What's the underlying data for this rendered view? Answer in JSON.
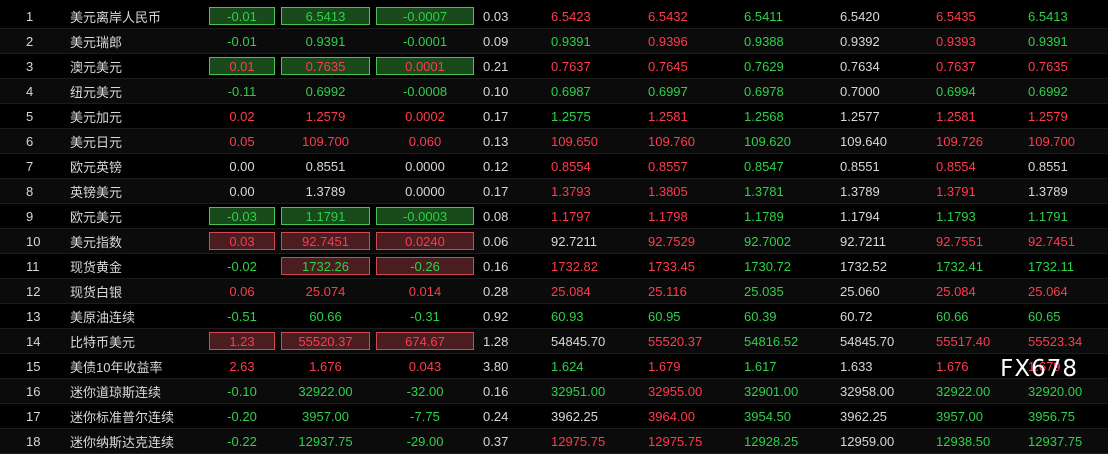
{
  "colors": {
    "up": "#ff3b4e",
    "down": "#2fd04a",
    "flat": "#d8d8d8",
    "background": "#000000"
  },
  "watermark": "FX678",
  "rows": [
    {
      "no": "1",
      "name": "美元离岸人民币",
      "change": "-0.01",
      "last": "6.5413",
      "chg": "-0.0007",
      "pct": "0.03",
      "open": "6.5423",
      "high": "6.5432",
      "low": "6.5411",
      "prev": "6.5420",
      "bid": "6.5435",
      "ask": "6.5413",
      "hl": "green",
      "c_change": "down",
      "c_last": "down",
      "c_chg": "down",
      "c_open": "up",
      "c_high": "up",
      "c_low": "down",
      "c_prev": "flat",
      "c_bid": "up",
      "c_ask": "down"
    },
    {
      "no": "2",
      "name": "美元瑞郎",
      "change": "-0.01",
      "last": "0.9391",
      "chg": "-0.0001",
      "pct": "0.09",
      "open": "0.9391",
      "high": "0.9396",
      "low": "0.9388",
      "prev": "0.9392",
      "bid": "0.9393",
      "ask": "0.9391",
      "hl": "",
      "c_change": "down",
      "c_last": "down",
      "c_chg": "down",
      "c_open": "down",
      "c_high": "up",
      "c_low": "down",
      "c_prev": "flat",
      "c_bid": "up",
      "c_ask": "down"
    },
    {
      "no": "3",
      "name": "澳元美元",
      "change": "0.01",
      "last": "0.7635",
      "chg": "0.0001",
      "pct": "0.21",
      "open": "0.7637",
      "high": "0.7645",
      "low": "0.7629",
      "prev": "0.7634",
      "bid": "0.7637",
      "ask": "0.7635",
      "hl": "green",
      "c_change": "up",
      "c_last": "up",
      "c_chg": "up",
      "c_open": "up",
      "c_high": "up",
      "c_low": "down",
      "c_prev": "flat",
      "c_bid": "up",
      "c_ask": "up"
    },
    {
      "no": "4",
      "name": "纽元美元",
      "change": "-0.11",
      "last": "0.6992",
      "chg": "-0.0008",
      "pct": "0.10",
      "open": "0.6987",
      "high": "0.6997",
      "low": "0.6978",
      "prev": "0.7000",
      "bid": "0.6994",
      "ask": "0.6992",
      "hl": "",
      "c_change": "down",
      "c_last": "down",
      "c_chg": "down",
      "c_open": "down",
      "c_high": "down",
      "c_low": "down",
      "c_prev": "flat",
      "c_bid": "down",
      "c_ask": "down"
    },
    {
      "no": "5",
      "name": "美元加元",
      "change": "0.02",
      "last": "1.2579",
      "chg": "0.0002",
      "pct": "0.17",
      "open": "1.2575",
      "high": "1.2581",
      "low": "1.2568",
      "prev": "1.2577",
      "bid": "1.2581",
      "ask": "1.2579",
      "hl": "",
      "c_change": "up",
      "c_last": "up",
      "c_chg": "up",
      "c_open": "down",
      "c_high": "up",
      "c_low": "down",
      "c_prev": "flat",
      "c_bid": "up",
      "c_ask": "up"
    },
    {
      "no": "6",
      "name": "美元日元",
      "change": "0.05",
      "last": "109.700",
      "chg": "0.060",
      "pct": "0.13",
      "open": "109.650",
      "high": "109.760",
      "low": "109.620",
      "prev": "109.640",
      "bid": "109.726",
      "ask": "109.700",
      "hl": "",
      "c_change": "up",
      "c_last": "up",
      "c_chg": "up",
      "c_open": "up",
      "c_high": "up",
      "c_low": "down",
      "c_prev": "flat",
      "c_bid": "up",
      "c_ask": "up"
    },
    {
      "no": "7",
      "name": "欧元英镑",
      "change": "0.00",
      "last": "0.8551",
      "chg": "0.0000",
      "pct": "0.12",
      "open": "0.8554",
      "high": "0.8557",
      "low": "0.8547",
      "prev": "0.8551",
      "bid": "0.8554",
      "ask": "0.8551",
      "hl": "",
      "c_change": "flat",
      "c_last": "flat",
      "c_chg": "flat",
      "c_open": "up",
      "c_high": "up",
      "c_low": "down",
      "c_prev": "flat",
      "c_bid": "up",
      "c_ask": "flat"
    },
    {
      "no": "8",
      "name": "英镑美元",
      "change": "0.00",
      "last": "1.3789",
      "chg": "0.0000",
      "pct": "0.17",
      "open": "1.3793",
      "high": "1.3805",
      "low": "1.3781",
      "prev": "1.3789",
      "bid": "1.3791",
      "ask": "1.3789",
      "hl": "",
      "c_change": "flat",
      "c_last": "flat",
      "c_chg": "flat",
      "c_open": "up",
      "c_high": "up",
      "c_low": "down",
      "c_prev": "flat",
      "c_bid": "up",
      "c_ask": "flat"
    },
    {
      "no": "9",
      "name": "欧元美元",
      "change": "-0.03",
      "last": "1.1791",
      "chg": "-0.0003",
      "pct": "0.08",
      "open": "1.1797",
      "high": "1.1798",
      "low": "1.1789",
      "prev": "1.1794",
      "bid": "1.1793",
      "ask": "1.1791",
      "hl": "green",
      "c_change": "down",
      "c_last": "down",
      "c_chg": "down",
      "c_open": "up",
      "c_high": "up",
      "c_low": "down",
      "c_prev": "flat",
      "c_bid": "down",
      "c_ask": "down"
    },
    {
      "no": "10",
      "name": "美元指数",
      "change": "0.03",
      "last": "92.7451",
      "chg": "0.0240",
      "pct": "0.06",
      "open": "92.7211",
      "high": "92.7529",
      "low": "92.7002",
      "prev": "92.7211",
      "bid": "92.7551",
      "ask": "92.7451",
      "hl": "red",
      "c_change": "up",
      "c_last": "up",
      "c_chg": "up",
      "c_open": "flat",
      "c_high": "up",
      "c_low": "down",
      "c_prev": "flat",
      "c_bid": "up",
      "c_ask": "up"
    },
    {
      "no": "11",
      "name": "现货黄金",
      "change": "-0.02",
      "last": "1732.26",
      "chg": "-0.26",
      "pct": "0.16",
      "open": "1732.82",
      "high": "1733.45",
      "low": "1730.72",
      "prev": "1732.52",
      "bid": "1732.41",
      "ask": "1732.11",
      "hl": "red-partial",
      "c_change": "down",
      "c_last": "down",
      "c_chg": "down",
      "c_open": "up",
      "c_high": "up",
      "c_low": "down",
      "c_prev": "flat",
      "c_bid": "down",
      "c_ask": "down"
    },
    {
      "no": "12",
      "name": "现货白银",
      "change": "0.06",
      "last": "25.074",
      "chg": "0.014",
      "pct": "0.28",
      "open": "25.084",
      "high": "25.116",
      "low": "25.035",
      "prev": "25.060",
      "bid": "25.084",
      "ask": "25.064",
      "hl": "",
      "c_change": "up",
      "c_last": "up",
      "c_chg": "up",
      "c_open": "up",
      "c_high": "up",
      "c_low": "down",
      "c_prev": "flat",
      "c_bid": "up",
      "c_ask": "up"
    },
    {
      "no": "13",
      "name": "美原油连续",
      "change": "-0.51",
      "last": "60.66",
      "chg": "-0.31",
      "pct": "0.92",
      "open": "60.93",
      "high": "60.95",
      "low": "60.39",
      "prev": "60.72",
      "bid": "60.66",
      "ask": "60.65",
      "hl": "",
      "c_change": "down",
      "c_last": "down",
      "c_chg": "down",
      "c_open": "down",
      "c_high": "down",
      "c_low": "down",
      "c_prev": "flat",
      "c_bid": "down",
      "c_ask": "down"
    },
    {
      "no": "14",
      "name": "比特币美元",
      "change": "1.23",
      "last": "55520.37",
      "chg": "674.67",
      "pct": "1.28",
      "open": "54845.70",
      "high": "55520.37",
      "low": "54816.52",
      "prev": "54845.70",
      "bid": "55517.40",
      "ask": "55523.34",
      "hl": "red",
      "c_change": "up",
      "c_last": "up",
      "c_chg": "up",
      "c_open": "flat",
      "c_high": "up",
      "c_low": "down",
      "c_prev": "flat",
      "c_bid": "up",
      "c_ask": "up"
    },
    {
      "no": "15",
      "name": "美债10年收益率",
      "change": "2.63",
      "last": "1.676",
      "chg": "0.043",
      "pct": "3.80",
      "open": "1.624",
      "high": "1.679",
      "low": "1.617",
      "prev": "1.633",
      "bid": "1.676",
      "ask": "1.679",
      "hl": "",
      "c_change": "up",
      "c_last": "up",
      "c_chg": "up",
      "c_open": "down",
      "c_high": "up",
      "c_low": "down",
      "c_prev": "flat",
      "c_bid": "up",
      "c_ask": "up"
    },
    {
      "no": "16",
      "name": "迷你道琼斯连续",
      "change": "-0.10",
      "last": "32922.00",
      "chg": "-32.00",
      "pct": "0.16",
      "open": "32951.00",
      "high": "32955.00",
      "low": "32901.00",
      "prev": "32958.00",
      "bid": "32922.00",
      "ask": "32920.00",
      "hl": "",
      "c_change": "down",
      "c_last": "down",
      "c_chg": "down",
      "c_open": "down",
      "c_high": "up",
      "c_low": "down",
      "c_prev": "flat",
      "c_bid": "down",
      "c_ask": "down"
    },
    {
      "no": "17",
      "name": "迷你标准普尔连续",
      "change": "-0.20",
      "last": "3957.00",
      "chg": "-7.75",
      "pct": "0.24",
      "open": "3962.25",
      "high": "3964.00",
      "low": "3954.50",
      "prev": "3962.25",
      "bid": "3957.00",
      "ask": "3956.75",
      "hl": "",
      "c_change": "down",
      "c_last": "down",
      "c_chg": "down",
      "c_open": "flat",
      "c_high": "up",
      "c_low": "down",
      "c_prev": "flat",
      "c_bid": "down",
      "c_ask": "down"
    },
    {
      "no": "18",
      "name": "迷你纳斯达克连续",
      "change": "-0.22",
      "last": "12937.75",
      "chg": "-29.00",
      "pct": "0.37",
      "open": "12975.75",
      "high": "12975.75",
      "low": "12928.25",
      "prev": "12959.00",
      "bid": "12938.50",
      "ask": "12937.75",
      "hl": "",
      "c_change": "down",
      "c_last": "down",
      "c_chg": "down",
      "c_open": "up",
      "c_high": "up",
      "c_low": "down",
      "c_prev": "flat",
      "c_bid": "down",
      "c_ask": "down"
    }
  ]
}
